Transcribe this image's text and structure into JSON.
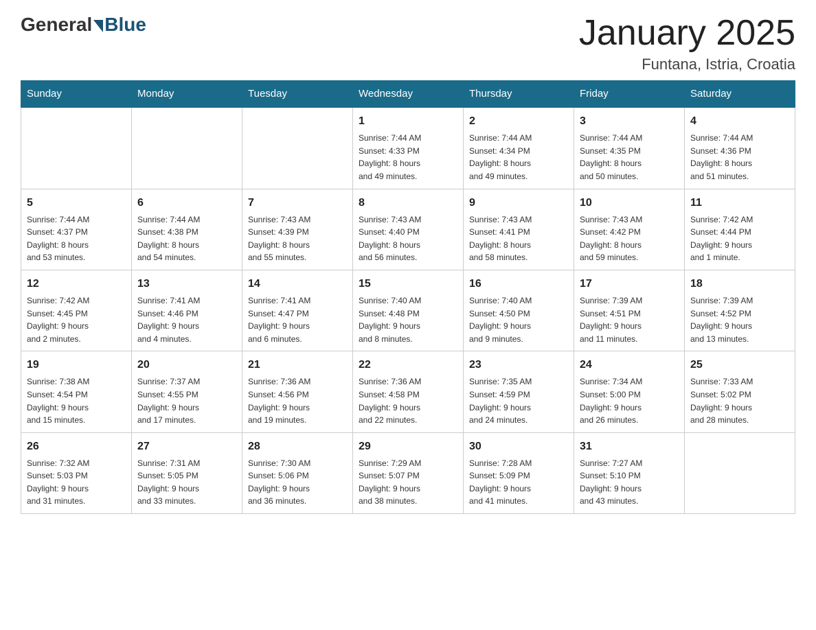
{
  "header": {
    "logo_general": "General",
    "logo_blue": "Blue",
    "title": "January 2025",
    "subtitle": "Funtana, Istria, Croatia"
  },
  "weekdays": [
    "Sunday",
    "Monday",
    "Tuesday",
    "Wednesday",
    "Thursday",
    "Friday",
    "Saturday"
  ],
  "weeks": [
    [
      {
        "day": "",
        "info": ""
      },
      {
        "day": "",
        "info": ""
      },
      {
        "day": "",
        "info": ""
      },
      {
        "day": "1",
        "info": "Sunrise: 7:44 AM\nSunset: 4:33 PM\nDaylight: 8 hours\nand 49 minutes."
      },
      {
        "day": "2",
        "info": "Sunrise: 7:44 AM\nSunset: 4:34 PM\nDaylight: 8 hours\nand 49 minutes."
      },
      {
        "day": "3",
        "info": "Sunrise: 7:44 AM\nSunset: 4:35 PM\nDaylight: 8 hours\nand 50 minutes."
      },
      {
        "day": "4",
        "info": "Sunrise: 7:44 AM\nSunset: 4:36 PM\nDaylight: 8 hours\nand 51 minutes."
      }
    ],
    [
      {
        "day": "5",
        "info": "Sunrise: 7:44 AM\nSunset: 4:37 PM\nDaylight: 8 hours\nand 53 minutes."
      },
      {
        "day": "6",
        "info": "Sunrise: 7:44 AM\nSunset: 4:38 PM\nDaylight: 8 hours\nand 54 minutes."
      },
      {
        "day": "7",
        "info": "Sunrise: 7:43 AM\nSunset: 4:39 PM\nDaylight: 8 hours\nand 55 minutes."
      },
      {
        "day": "8",
        "info": "Sunrise: 7:43 AM\nSunset: 4:40 PM\nDaylight: 8 hours\nand 56 minutes."
      },
      {
        "day": "9",
        "info": "Sunrise: 7:43 AM\nSunset: 4:41 PM\nDaylight: 8 hours\nand 58 minutes."
      },
      {
        "day": "10",
        "info": "Sunrise: 7:43 AM\nSunset: 4:42 PM\nDaylight: 8 hours\nand 59 minutes."
      },
      {
        "day": "11",
        "info": "Sunrise: 7:42 AM\nSunset: 4:44 PM\nDaylight: 9 hours\nand 1 minute."
      }
    ],
    [
      {
        "day": "12",
        "info": "Sunrise: 7:42 AM\nSunset: 4:45 PM\nDaylight: 9 hours\nand 2 minutes."
      },
      {
        "day": "13",
        "info": "Sunrise: 7:41 AM\nSunset: 4:46 PM\nDaylight: 9 hours\nand 4 minutes."
      },
      {
        "day": "14",
        "info": "Sunrise: 7:41 AM\nSunset: 4:47 PM\nDaylight: 9 hours\nand 6 minutes."
      },
      {
        "day": "15",
        "info": "Sunrise: 7:40 AM\nSunset: 4:48 PM\nDaylight: 9 hours\nand 8 minutes."
      },
      {
        "day": "16",
        "info": "Sunrise: 7:40 AM\nSunset: 4:50 PM\nDaylight: 9 hours\nand 9 minutes."
      },
      {
        "day": "17",
        "info": "Sunrise: 7:39 AM\nSunset: 4:51 PM\nDaylight: 9 hours\nand 11 minutes."
      },
      {
        "day": "18",
        "info": "Sunrise: 7:39 AM\nSunset: 4:52 PM\nDaylight: 9 hours\nand 13 minutes."
      }
    ],
    [
      {
        "day": "19",
        "info": "Sunrise: 7:38 AM\nSunset: 4:54 PM\nDaylight: 9 hours\nand 15 minutes."
      },
      {
        "day": "20",
        "info": "Sunrise: 7:37 AM\nSunset: 4:55 PM\nDaylight: 9 hours\nand 17 minutes."
      },
      {
        "day": "21",
        "info": "Sunrise: 7:36 AM\nSunset: 4:56 PM\nDaylight: 9 hours\nand 19 minutes."
      },
      {
        "day": "22",
        "info": "Sunrise: 7:36 AM\nSunset: 4:58 PM\nDaylight: 9 hours\nand 22 minutes."
      },
      {
        "day": "23",
        "info": "Sunrise: 7:35 AM\nSunset: 4:59 PM\nDaylight: 9 hours\nand 24 minutes."
      },
      {
        "day": "24",
        "info": "Sunrise: 7:34 AM\nSunset: 5:00 PM\nDaylight: 9 hours\nand 26 minutes."
      },
      {
        "day": "25",
        "info": "Sunrise: 7:33 AM\nSunset: 5:02 PM\nDaylight: 9 hours\nand 28 minutes."
      }
    ],
    [
      {
        "day": "26",
        "info": "Sunrise: 7:32 AM\nSunset: 5:03 PM\nDaylight: 9 hours\nand 31 minutes."
      },
      {
        "day": "27",
        "info": "Sunrise: 7:31 AM\nSunset: 5:05 PM\nDaylight: 9 hours\nand 33 minutes."
      },
      {
        "day": "28",
        "info": "Sunrise: 7:30 AM\nSunset: 5:06 PM\nDaylight: 9 hours\nand 36 minutes."
      },
      {
        "day": "29",
        "info": "Sunrise: 7:29 AM\nSunset: 5:07 PM\nDaylight: 9 hours\nand 38 minutes."
      },
      {
        "day": "30",
        "info": "Sunrise: 7:28 AM\nSunset: 5:09 PM\nDaylight: 9 hours\nand 41 minutes."
      },
      {
        "day": "31",
        "info": "Sunrise: 7:27 AM\nSunset: 5:10 PM\nDaylight: 9 hours\nand 43 minutes."
      },
      {
        "day": "",
        "info": ""
      }
    ]
  ]
}
